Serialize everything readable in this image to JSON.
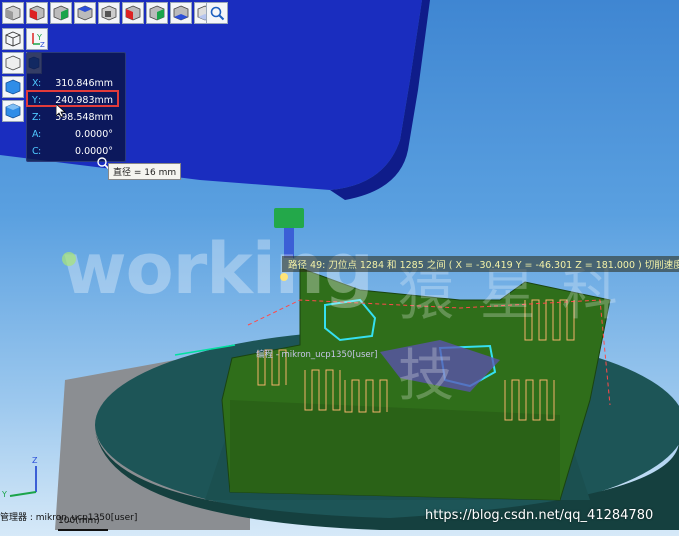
{
  "coordinates": [
    {
      "axis": "X",
      "value": "310.846mm"
    },
    {
      "axis": "Y",
      "value": "240.983mm"
    },
    {
      "axis": "Z",
      "value": "598.548mm"
    },
    {
      "axis": "A",
      "value": "0.0000°"
    },
    {
      "axis": "C",
      "value": "0.0000°"
    }
  ],
  "tool_diameter_label": "直径 = 16 mm",
  "path_tooltip": "路径 49: 刀位点 1284 和 1285 之间 ( X = -30.419  Y = -46.301  Z = 181.000 ) 切削速度",
  "session_label": "编程 - mikron_ucp1350[user]",
  "status_bottom": "管理器 : mikron_ucp1350[user]",
  "scale_label": "100(mm)",
  "watermark_left": "working",
  "watermark_right": "猿 星 科 技",
  "url_watermark": "https://blog.csdn.net/qq_41284780",
  "axis_triad": {
    "y_label": "Y",
    "z_label": "Z"
  },
  "colors": {
    "background_top": "#3f86d2",
    "spindle": "#1a2dbf",
    "part": "#2f6e1a",
    "fixture": "#1f5a5a",
    "highlight": "#e23b3b",
    "coord_axis": "#4fc8ff"
  },
  "toolbar_icons": [
    "iso-cube-icon",
    "front-view-icon",
    "left-view-icon",
    "top-view-icon",
    "back-view-icon",
    "right-view-icon",
    "bottom-view-icon",
    "zoom-fit-icon"
  ],
  "side_icons": [
    "wireframe-cube-icon",
    "axis-yz-icon",
    "shaded-cube-icon",
    "solid-blue-cube-icon"
  ]
}
